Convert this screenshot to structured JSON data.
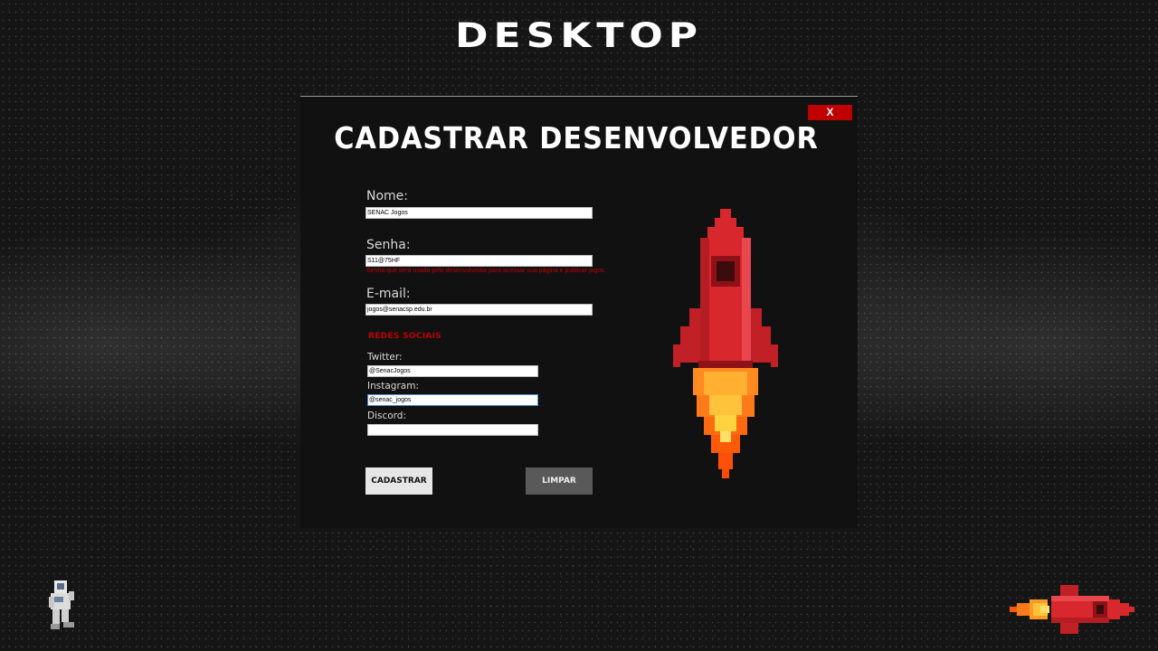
{
  "page": {
    "title": "DESKTOP"
  },
  "dialog": {
    "title": "CADASTRAR DESENVOLVEDOR",
    "close_label": "X",
    "fields": {
      "name": {
        "label": "Nome:",
        "value": "SENAC Jogos"
      },
      "password": {
        "label": "Senha:",
        "value": "S11@75HF",
        "hint": "Senha que será usada pelo desenvolvedor para acessar sua página e publicar jogos."
      },
      "email": {
        "label": "E-mail:",
        "value": "jogos@senacsp.edu.br"
      }
    },
    "social": {
      "heading": "REDES SOCIAIS",
      "twitter": {
        "label": "Twitter:",
        "value": "@SenacJogos"
      },
      "instagram": {
        "label": "Instagram:",
        "value": "@senac_jogos"
      },
      "discord": {
        "label": "Discord:",
        "value": ""
      }
    },
    "buttons": {
      "submit": "CADASTRAR",
      "clear": "LIMPAR"
    }
  },
  "icons": {
    "hero": "rocket-icon",
    "corner_left": "astronaut-icon",
    "corner_right": "rocket-icon"
  },
  "colors": {
    "accent": "#c00000",
    "dialog_bg": "#111111",
    "rocket_red": "#d9272e",
    "flame_orange": "#ff7a1a",
    "flame_yellow": "#ffd23f"
  }
}
